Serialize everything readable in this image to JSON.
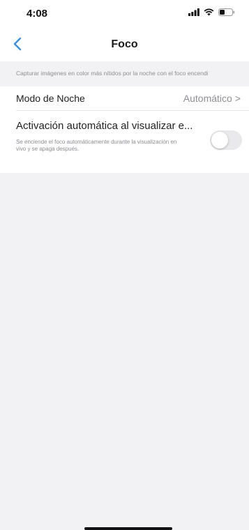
{
  "status_bar": {
    "time": "4:08",
    "icons": [
      "signal-icon",
      "wifi-icon",
      "battery-icon"
    ]
  },
  "nav": {
    "title": "Foco",
    "back_icon": "chevron-left-icon",
    "accent_color": "#3a8fd9"
  },
  "settings": {
    "caption": "Capturar imágenes en color más nítidos por la noche con el foco encendi",
    "night_mode": {
      "label": "Modo de Noche",
      "value": "Automático",
      "arrow": ">"
    },
    "auto_activation": {
      "title": "Activación automática al visualizar e...",
      "description": "Se enciende el foco automáticamente durante la visualización en vivo y se apaga después.",
      "enabled": false
    }
  }
}
